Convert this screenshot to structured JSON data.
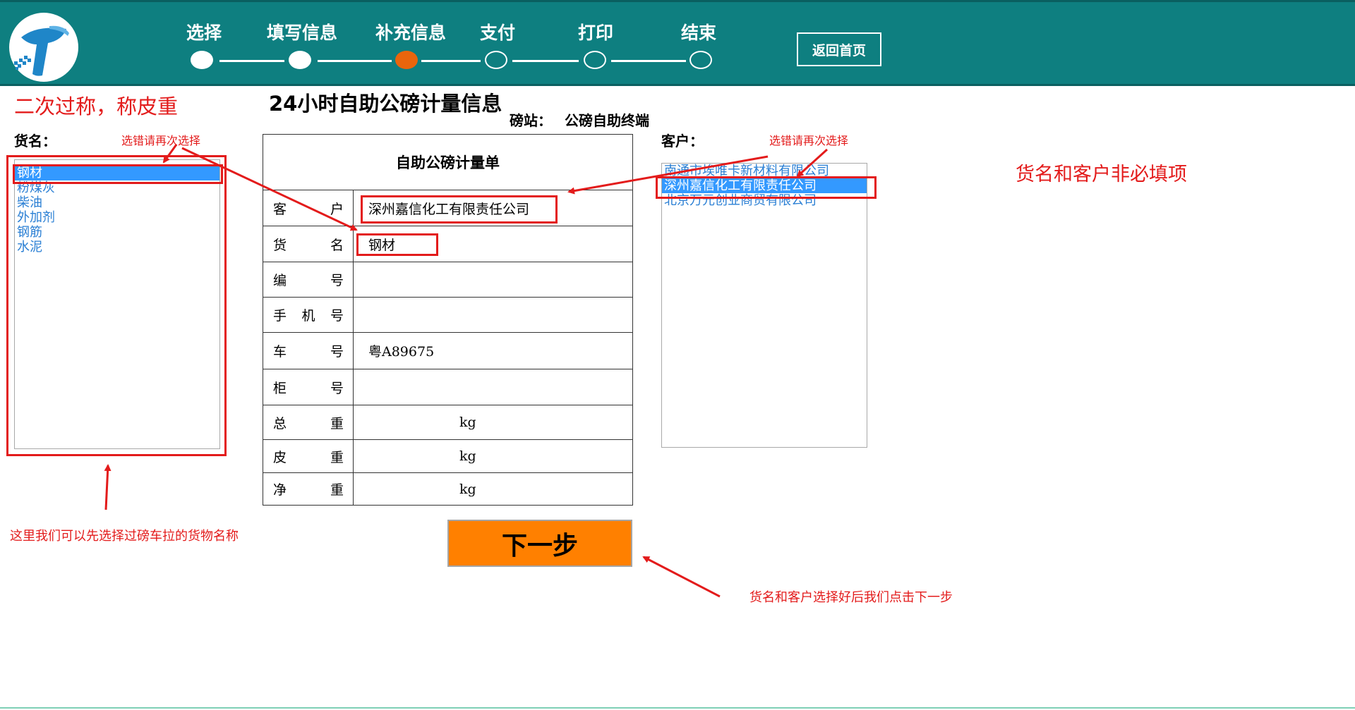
{
  "header": {
    "steps": [
      {
        "label": "选择",
        "state": "done"
      },
      {
        "label": "填写信息",
        "state": "done"
      },
      {
        "label": "补充信息",
        "state": "current"
      },
      {
        "label": "支付",
        "state": "todo"
      },
      {
        "label": "打印",
        "state": "todo"
      },
      {
        "label": "结束",
        "state": "todo"
      }
    ],
    "home_button": "返回首页",
    "colors": {
      "bar": "#0e7f80",
      "current_step": "#e9650c"
    }
  },
  "notes": {
    "second_weigh": "二次过称，称皮重",
    "reselect_left": "选错请再次选择",
    "reselect_right": "选错请再次选择",
    "optional_hint": "货名和客户非必填项",
    "goods_hint": "这里我们可以先选择过磅车拉的货物名称",
    "next_hint": "货名和客户选择好后我们点击下一步"
  },
  "page": {
    "title": "24小时自助公磅计量信息",
    "station_label": "磅站：",
    "station_name": "公磅自助终端"
  },
  "goods": {
    "label": "货名：",
    "items": [
      "钢材",
      "粉煤灰",
      "柴油",
      "外加剂",
      "钢筋",
      "水泥"
    ],
    "selected_index": 0
  },
  "customer": {
    "label": "客户：",
    "items": [
      "南通市埃唯卡新材料有限公司",
      "深州嘉信化工有限责任公司",
      "北京万元创业商贸有限公司"
    ],
    "selected_index": 1
  },
  "form": {
    "title": "自助公磅计量单",
    "rows": [
      {
        "label": [
          "客",
          "户"
        ],
        "value": "深州嘉信化工有限责任公司"
      },
      {
        "label": [
          "货",
          "名"
        ],
        "value": "钢材"
      },
      {
        "label": [
          "编",
          "号"
        ],
        "value": ""
      },
      {
        "label": [
          "手",
          "机",
          "号"
        ],
        "value": ""
      },
      {
        "label": [
          "车",
          "号"
        ],
        "value": "粤A89675"
      },
      {
        "label": [
          "柜",
          "号"
        ],
        "value": ""
      },
      {
        "label": [
          "总",
          "重"
        ],
        "unit": "kg"
      },
      {
        "label": [
          "皮",
          "重"
        ],
        "unit": "kg"
      },
      {
        "label": [
          "净",
          "重"
        ],
        "unit": "kg"
      }
    ]
  },
  "next_button": "下一步"
}
